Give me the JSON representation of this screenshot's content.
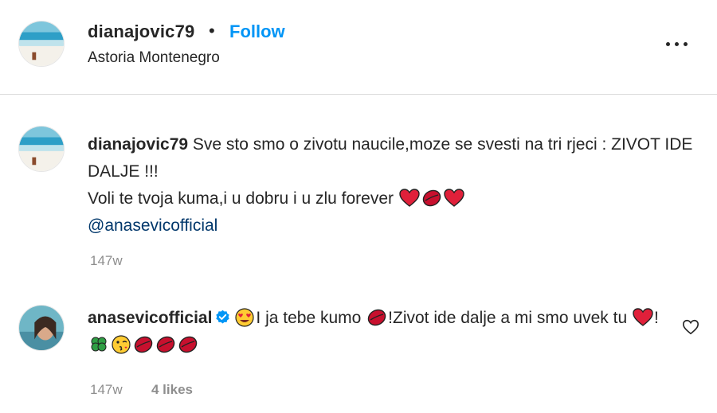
{
  "post_header": {
    "username": "dianajovic79",
    "separator": "•",
    "follow_label": "Follow",
    "location": "Astoria Montenegro"
  },
  "caption": {
    "username": "dianajovic79",
    "text_line1": "Sve sto smo o zivotu naucile,moze se svesti na tri rjeci : ZIVOT IDE DALJE !!!",
    "text_line2": "Voli te tvoja kuma,i u dobru i u zlu forever",
    "line2_emojis": [
      "red-heart",
      "kiss-mark",
      "red-heart"
    ],
    "mention": "@anasevicofficial",
    "timestamp": "147w"
  },
  "comment": {
    "username": "anasevicofficial",
    "verified": true,
    "text_part1": "I ja tebe kumo",
    "text_part2": "!Zivot ide dalje a mi smo uvek tu",
    "text_part3": "!",
    "emojis_start": [
      "heart-eyes"
    ],
    "emojis_mid": [
      "kiss-mark"
    ],
    "emojis_after_tu": [
      "red-heart"
    ],
    "emojis_end": [
      "four-leaf-clover",
      "winking-kiss-face",
      "kiss-mark",
      "kiss-mark",
      "kiss-mark"
    ],
    "timestamp": "147w",
    "likes": "4 likes"
  },
  "colors": {
    "text": "#262626",
    "follow_blue": "#0095f6",
    "mention_blue": "#00376b",
    "muted": "#8e8e8e",
    "divider": "#dbdbdb",
    "heart_red": "#e0203a",
    "lips_red": "#c8102e"
  }
}
